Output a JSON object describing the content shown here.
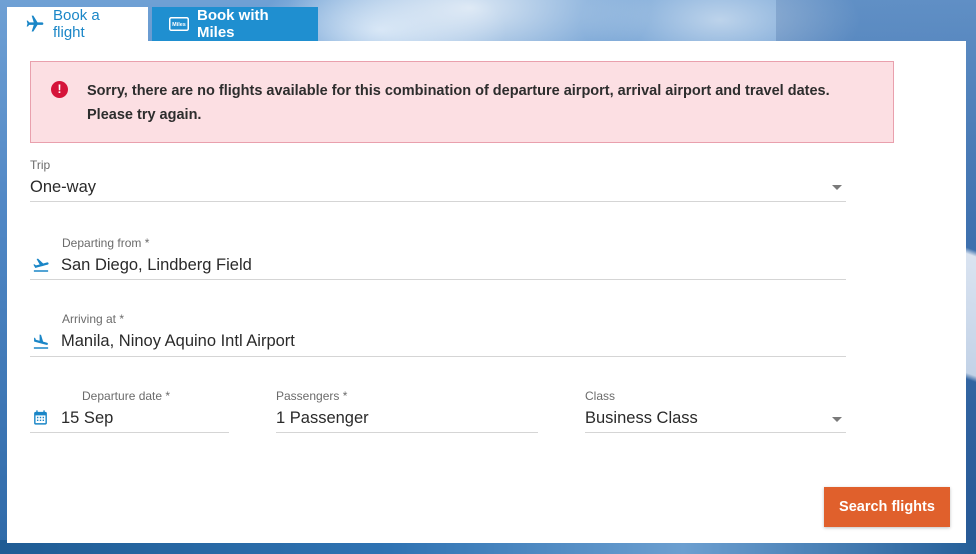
{
  "tabs": [
    {
      "label": "Book a flight",
      "icon": "airplane-icon"
    },
    {
      "label": "Book with Miles",
      "icon": "miles-card-icon",
      "icon_text": "Miles"
    }
  ],
  "alert": {
    "icon": "error-icon",
    "icon_glyph": "!",
    "message": "Sorry, there are no flights available for this combination of departure airport, arrival airport and travel dates. Please try again."
  },
  "form": {
    "trip": {
      "label": "Trip",
      "value": "One-way"
    },
    "departing": {
      "label": "Departing from *",
      "value": "San Diego, Lindberg Field",
      "icon": "takeoff-icon"
    },
    "arriving": {
      "label": "Arriving at *",
      "value": "Manila, Ninoy Aquino Intl Airport",
      "icon": "landing-icon"
    },
    "departure_date": {
      "label": "Departure date *",
      "value": "15 Sep",
      "icon": "calendar-icon"
    },
    "passengers": {
      "label": "Passengers *",
      "value": "1 Passenger"
    },
    "class": {
      "label": "Class",
      "value": "Business Class"
    }
  },
  "search_button": {
    "label": "Search flights"
  },
  "colors": {
    "accent": "#1a86c7",
    "tab_inactive": "#1f8fd0",
    "alert_bg": "#fcdfe3",
    "alert_border": "#e9a0ad",
    "error": "#d5143a",
    "button": "#e0602c"
  }
}
